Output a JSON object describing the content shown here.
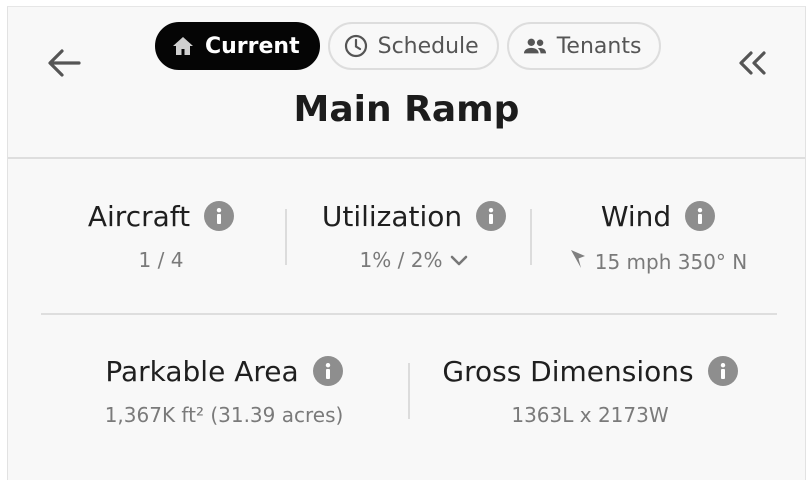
{
  "tabs": [
    {
      "label": "Current",
      "icon": "home-icon",
      "active": true
    },
    {
      "label": "Schedule",
      "icon": "clock-icon",
      "active": false
    },
    {
      "label": "Tenants",
      "icon": "people-icon",
      "active": false
    }
  ],
  "title": "Main Ramp",
  "stats": {
    "aircraft": {
      "label": "Aircraft",
      "value": "1 / 4"
    },
    "utilization": {
      "label": "Utilization",
      "value": "1% / 2%"
    },
    "wind": {
      "label": "Wind",
      "value": "15 mph 350° N"
    },
    "parkable_area": {
      "label": "Parkable Area",
      "value": "1,367K ft² (31.39 acres)"
    },
    "gross_dimensions": {
      "label": "Gross Dimensions",
      "value": "1363L x 2173W"
    }
  },
  "colors": {
    "active_tab_bg": "#050505",
    "info_icon": "#8e8e8e",
    "muted_text": "#7a7a7a"
  }
}
